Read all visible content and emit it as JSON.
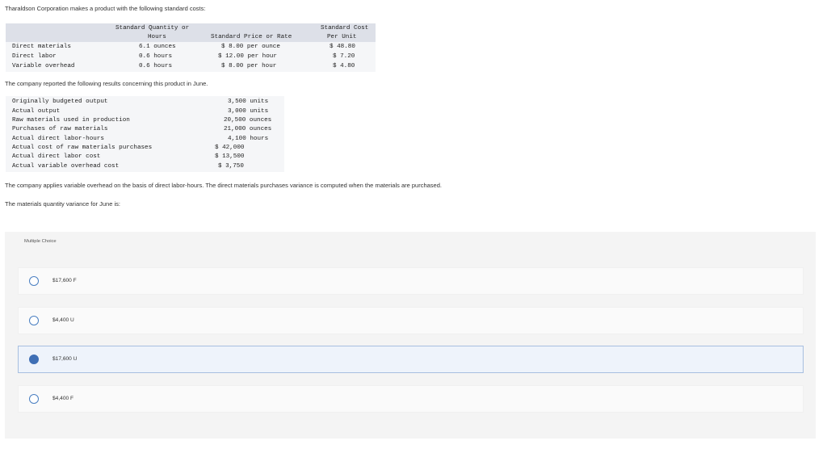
{
  "intro": "Tharaldson Corporation makes a product with the following standard costs:",
  "standard_table": {
    "headers": {
      "qty_line1": "Standard Quantity or",
      "qty_line2": "Hours",
      "price": "Standard Price or Rate",
      "cost_line1": "Standard Cost",
      "cost_line2": "Per Unit"
    },
    "rows": [
      {
        "label": "Direct materials",
        "qty": "6.1 ounces",
        "price": "$ 8.00 per ounce",
        "cost": "$ 48.80"
      },
      {
        "label": "Direct labor",
        "qty": "0.6 hours",
        "price": "$ 12.00 per hour",
        "cost": "$ 7.20"
      },
      {
        "label": "Variable overhead",
        "qty": "0.6 hours",
        "price": "$ 8.00 per hour",
        "cost": "$ 4.80"
      }
    ]
  },
  "results_intro": "The company reported the following results concerning this product in June.",
  "results_table": [
    {
      "label": "Originally budgeted output",
      "value": "3,500 units"
    },
    {
      "label": "Actual output",
      "value": "3,000 units"
    },
    {
      "label": "Raw materials used in production",
      "value": "20,500 ounces"
    },
    {
      "label": "Purchases of raw materials",
      "value": "21,000 ounces"
    },
    {
      "label": "Actual direct labor-hours",
      "value": "4,100 hours"
    },
    {
      "label": "Actual cost of raw materials purchases",
      "value": "$ 42,000"
    },
    {
      "label": "Actual direct labor cost",
      "value": "$ 13,500"
    },
    {
      "label": "Actual variable overhead cost",
      "value": "$ 3,750"
    }
  ],
  "note": "The company applies variable overhead on the basis of direct labor-hours. The direct materials purchases variance is computed when the materials are purchased.",
  "question": "The materials quantity variance for June is:",
  "multiple_choice": {
    "label": "Multiple Choice",
    "options": [
      {
        "text": "$17,600 F",
        "selected": false
      },
      {
        "text": "$4,400 U",
        "selected": false
      },
      {
        "text": "$17,600 U",
        "selected": true
      },
      {
        "text": "$4,400 F",
        "selected": false
      }
    ]
  },
  "colors": {
    "accent": "#3f6fb5",
    "selected_bg": "#eef3fb",
    "selected_border": "#a7bfe0"
  }
}
